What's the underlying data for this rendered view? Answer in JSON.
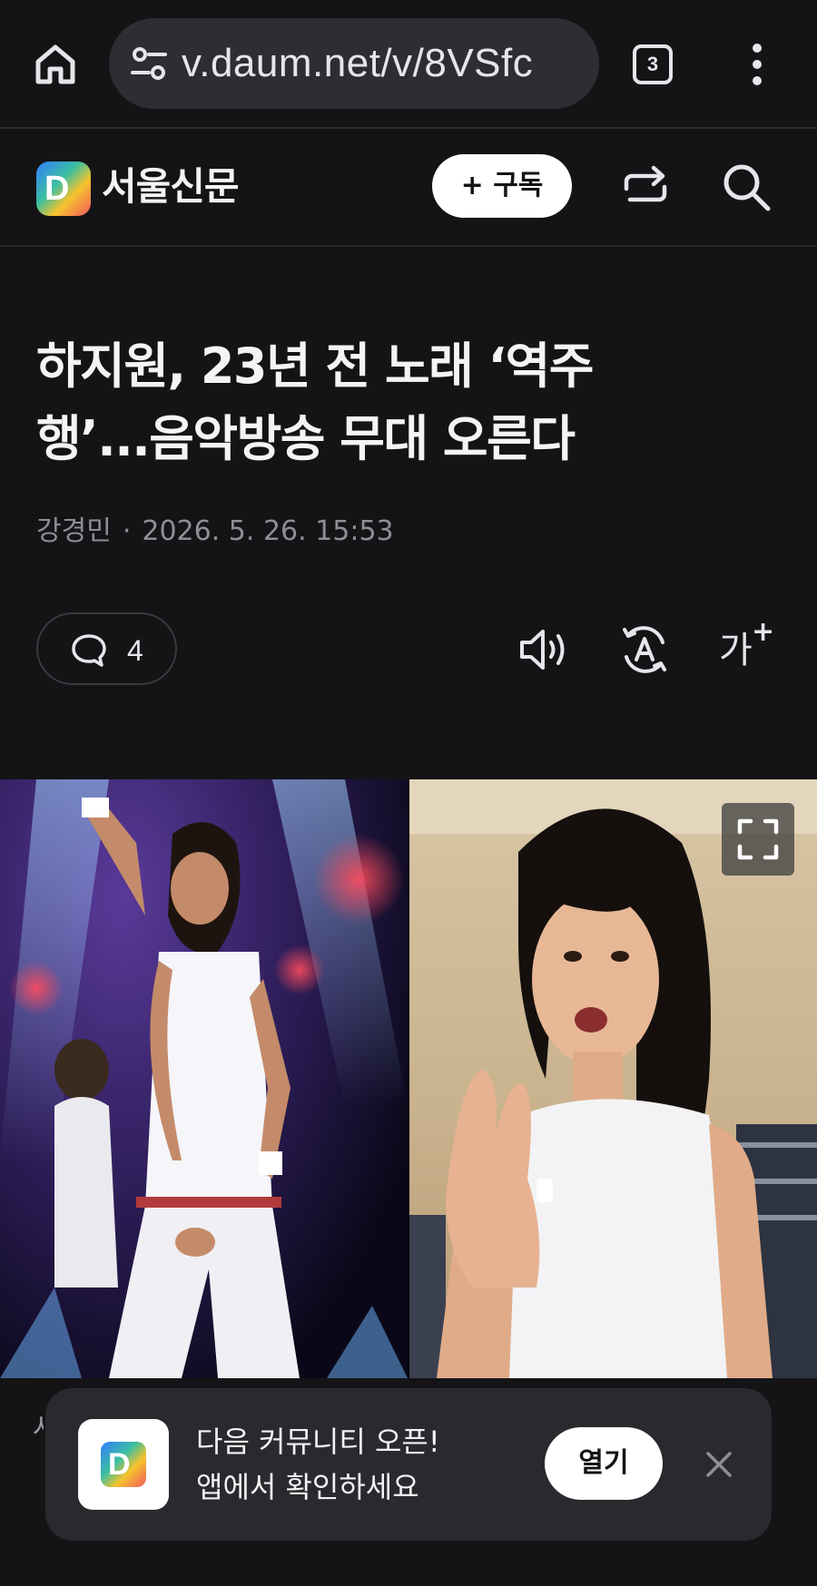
{
  "browser": {
    "url": "v.daum.net/v/8VSfc",
    "tab_count": "3"
  },
  "header": {
    "logo_letter": "D",
    "press_name": "서울신문",
    "subscribe_label": "+ 구독"
  },
  "article": {
    "title_line1": "하지원, 23년 전 노래 ‘역주",
    "title_line2": "행’...음악방송 무대 오른다",
    "author": "강경민",
    "separator": "·",
    "datetime": "2026. 5. 26. 15:53",
    "comment_count": "4",
    "fontsize_label": "가",
    "fontsize_plus": "+"
  },
  "banner": {
    "logo_letter": "D",
    "line1": "다음 커뮤니티 오픈!",
    "line2": "앱에서 확인하세요",
    "open_label": "열기",
    "peek_chars": "사"
  },
  "icons": {
    "home": "home-icon",
    "url_settings": "tune-icon",
    "more": "more-vertical-icon",
    "share": "share-icon",
    "search": "search-icon",
    "comment": "comment-icon",
    "tts": "speaker-icon",
    "translate": "translate-icon",
    "expand": "expand-icon",
    "close": "close-icon"
  }
}
